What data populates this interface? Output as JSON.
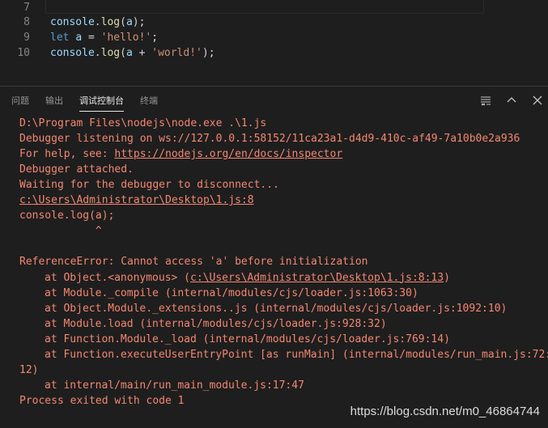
{
  "editor": {
    "lines": [
      {
        "n": "7",
        "tokens": []
      },
      {
        "n": "8",
        "tokens": [
          {
            "t": "console",
            "c": "tok-var"
          },
          {
            "t": ".",
            "c": "tok-p"
          },
          {
            "t": "log",
            "c": "tok-fn"
          },
          {
            "t": "(",
            "c": "tok-p"
          },
          {
            "t": "a",
            "c": "tok-var"
          },
          {
            "t": ");",
            "c": "tok-p"
          }
        ]
      },
      {
        "n": "9",
        "tokens": [
          {
            "t": "let",
            "c": "tok-kw"
          },
          {
            "t": " ",
            "c": "tok-p"
          },
          {
            "t": "a",
            "c": "tok-var"
          },
          {
            "t": " = ",
            "c": "tok-p"
          },
          {
            "t": "'hello!'",
            "c": "tok-str"
          },
          {
            "t": ";",
            "c": "tok-p"
          }
        ]
      },
      {
        "n": "10",
        "tokens": [
          {
            "t": "console",
            "c": "tok-var"
          },
          {
            "t": ".",
            "c": "tok-p"
          },
          {
            "t": "log",
            "c": "tok-fn"
          },
          {
            "t": "(",
            "c": "tok-p"
          },
          {
            "t": "a",
            "c": "tok-var"
          },
          {
            "t": " + ",
            "c": "tok-p"
          },
          {
            "t": "'world!'",
            "c": "tok-str"
          },
          {
            "t": ");",
            "c": "tok-p"
          }
        ]
      }
    ]
  },
  "panel": {
    "tabs": [
      {
        "label": "问题",
        "active": false
      },
      {
        "label": "输出",
        "active": false
      },
      {
        "label": "调试控制台",
        "active": true
      },
      {
        "label": "终端",
        "active": false
      }
    ],
    "actions": [
      {
        "icon": "list-filter-icon"
      },
      {
        "icon": "chevron-up-icon"
      },
      {
        "icon": "close-icon"
      }
    ]
  },
  "console": {
    "lines": [
      {
        "text": "D:\\Program Files\\nodejs\\node.exe .\\1.js",
        "indent": false
      },
      {
        "text": "Debugger listening on ws://127.0.0.1:58152/11ca23a1-d4d9-410c-af49-7a10b0e2a936",
        "indent": false
      },
      {
        "prefix": "For help, see: ",
        "link": "https://nodejs.org/en/docs/inspector",
        "indent": false
      },
      {
        "text": "Debugger attached.",
        "indent": false
      },
      {
        "text": "Waiting for the debugger to disconnect...",
        "indent": false
      },
      {
        "link": "c:\\Users\\Administrator\\Desktop\\1.js:8",
        "indent": false
      },
      {
        "text": "console.log(a);",
        "indent": false
      },
      {
        "text": "            ^",
        "indent": false
      },
      {
        "text": "",
        "indent": false
      },
      {
        "text": "ReferenceError: Cannot access 'a' before initialization",
        "indent": false
      },
      {
        "prefix": "at Object.<anonymous> (",
        "link": "c:\\Users\\Administrator\\Desktop\\1.js:8:13",
        "suffix": ")",
        "indent": true
      },
      {
        "text": "at Module._compile (internal/modules/cjs/loader.js:1063:30)",
        "indent": true
      },
      {
        "text": "at Object.Module._extensions..js (internal/modules/cjs/loader.js:1092:10)",
        "indent": true
      },
      {
        "text": "at Module.load (internal/modules/cjs/loader.js:928:32)",
        "indent": true
      },
      {
        "text": "at Function.Module._load (internal/modules/cjs/loader.js:769:14)",
        "indent": true
      },
      {
        "text": "at Function.executeUserEntryPoint [as runMain] (internal/modules/run_main.js:72:",
        "indent": true
      },
      {
        "text": "12)",
        "indent": false
      },
      {
        "text": "at internal/main/run_main_module.js:17:47",
        "indent": true
      },
      {
        "text": "Process exited with code 1",
        "indent": false
      }
    ]
  },
  "watermark": "https://blog.csdn.net/m0_46864744",
  "colors": {
    "background": "#1e1e1e",
    "error_text": "#f48771",
    "line_number": "#858585"
  }
}
